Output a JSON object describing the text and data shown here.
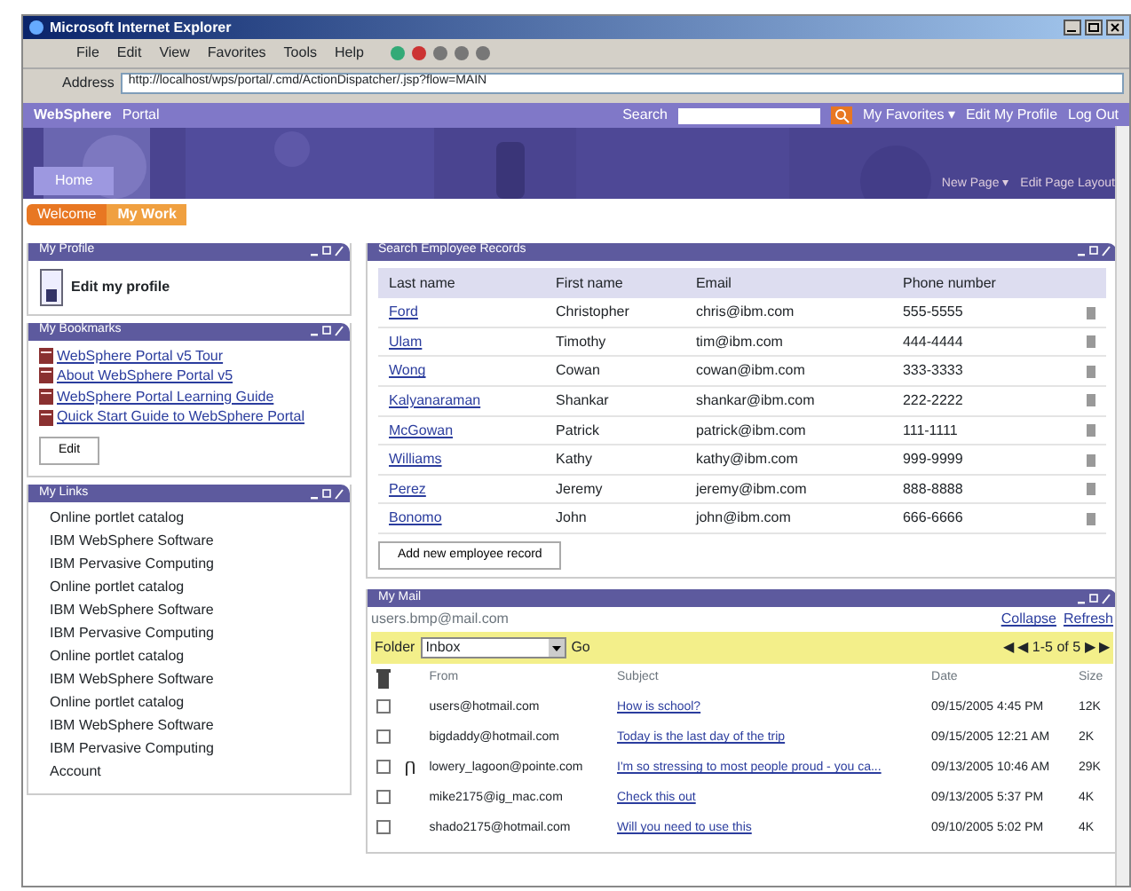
{
  "window": {
    "title": "Microsoft Internet Explorer"
  },
  "menu": [
    "File",
    "Edit",
    "View",
    "Favorites",
    "Tools",
    "Help"
  ],
  "address": {
    "label": "Address",
    "url": "http://localhost/wps/portal/.cmd/ActionDispatcher/.jsp?flow=MAIN"
  },
  "portal": {
    "brand": "WebSphere",
    "brand_sub": "Portal",
    "search_label": "Search",
    "links": [
      "My Favorites ▾",
      "Edit My Profile",
      "Log Out"
    ],
    "tabs": [
      {
        "label": "Home",
        "selected": true
      }
    ],
    "page_links": [
      "New Page ▾",
      "Edit Page Layout"
    ],
    "breadcrumb": [
      {
        "label": "Welcome",
        "selected": false
      },
      {
        "label": "My Work",
        "selected": true
      }
    ]
  },
  "profile": {
    "title": "My Profile",
    "link": "Edit my profile"
  },
  "bookmarks": {
    "title": "My Bookmarks",
    "items": [
      "WebSphere Portal v5 Tour",
      "About WebSphere Portal v5",
      "WebSphere Portal Learning Guide",
      "Quick Start Guide to WebSphere Portal"
    ],
    "button": "Edit"
  },
  "links": {
    "title": "My Links",
    "items": [
      "Online portlet catalog",
      "IBM WebSphere Software",
      "IBM Pervasive Computing",
      "Online portlet catalog",
      "IBM WebSphere Software",
      "IBM Pervasive Computing",
      "Online portlet catalog",
      "IBM WebSphere Software",
      "Online portlet catalog",
      "IBM WebSphere Software",
      "IBM Pervasive Computing",
      "Account"
    ]
  },
  "employees": {
    "title": "Search Employee Records",
    "columns": [
      "Last name",
      "First name",
      "Email",
      "Phone number"
    ],
    "rows": [
      [
        "Ford",
        "Christopher",
        "chris@ibm.com",
        "555-5555"
      ],
      [
        "Ulam",
        "Timothy",
        "tim@ibm.com",
        "444-4444"
      ],
      [
        "Wong",
        "Cowan",
        "cowan@ibm.com",
        "333-3333"
      ],
      [
        "Kalyanaraman",
        "Shankar",
        "shankar@ibm.com",
        "222-2222"
      ],
      [
        "McGowan",
        "Patrick",
        "patrick@ibm.com",
        "111-1111"
      ],
      [
        "Williams",
        "Kathy",
        "kathy@ibm.com",
        "999-9999"
      ],
      [
        "Perez",
        "Jeremy",
        "jeremy@ibm.com",
        "888-8888"
      ],
      [
        "Bonomo",
        "John",
        "john@ibm.com",
        "666-6666"
      ]
    ],
    "button": "Add new employee record"
  },
  "mail": {
    "title": "My Mail",
    "account": "users.bmp@mail.com",
    "actions": [
      "Collapse",
      "Refresh"
    ],
    "folder_label": "Folder",
    "folder": "Inbox",
    "go": "Go",
    "pager": "◀ ◀ 1-5 of 5 ▶ ▶",
    "columns": [
      "From",
      "Subject",
      "Date",
      "Size"
    ],
    "rows": [
      {
        "checked": false,
        "attachment": false,
        "from": "users@hotmail.com",
        "subject": "How is school?",
        "date": "09/15/2005 4:45 PM",
        "size": "12K"
      },
      {
        "checked": false,
        "attachment": false,
        "from": "bigdaddy@hotmail.com",
        "subject": "Today is the last day of the trip",
        "date": "09/15/2005 12:21 AM",
        "size": "2K"
      },
      {
        "checked": false,
        "attachment": true,
        "from": "lowery_lagoon@pointe.com",
        "subject": "I'm so stressing to most people proud - you ca...",
        "date": "09/13/2005 10:46 AM",
        "size": "29K"
      },
      {
        "checked": false,
        "attachment": false,
        "from": "mike2175@ig_mac.com",
        "subject": "Check this out",
        "date": "09/13/2005 5:37 PM",
        "size": "4K"
      },
      {
        "checked": false,
        "attachment": false,
        "from": "shado2175@hotmail.com",
        "subject": "Will you need to use this",
        "date": "09/10/2005 5:02 PM",
        "size": "4K"
      }
    ]
  }
}
